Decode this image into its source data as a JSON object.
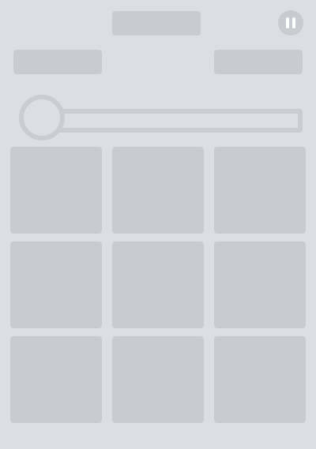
{
  "theme": {
    "background": "#DBDFE3",
    "placeholder": "#C8CCD1",
    "border": "#C9CDD2",
    "track_fill": "#DBDFE3",
    "pause_bar": "#FFFFFF"
  },
  "header": {
    "pause_icon": "pause-icon"
  },
  "timer": {
    "elapsed_fraction": 0
  },
  "grid": {
    "rows": 3,
    "columns": 3,
    "tile_count": 9
  }
}
